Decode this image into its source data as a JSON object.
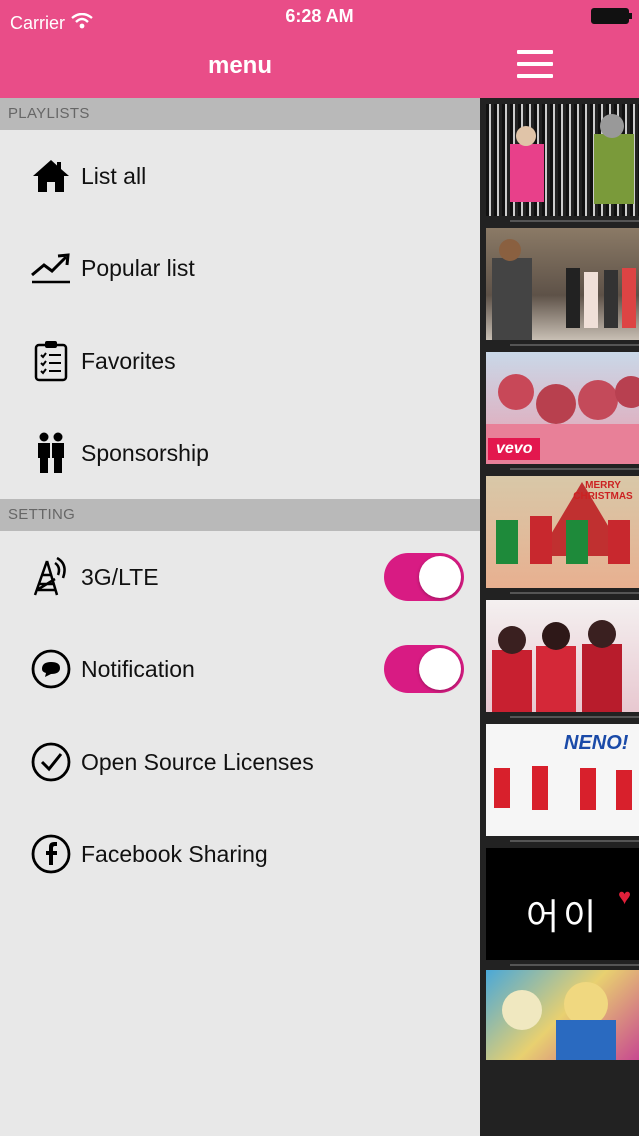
{
  "status_bar": {
    "carrier": "Carrier",
    "time": "6:28 AM"
  },
  "menu": {
    "title": "menu",
    "sections": [
      {
        "header": "PLAYLISTS",
        "items": [
          {
            "label": "List all",
            "icon": "home-icon"
          },
          {
            "label": "Popular list",
            "icon": "trending-up-icon"
          },
          {
            "label": "Favorites",
            "icon": "clipboard-checklist-icon"
          },
          {
            "label": "Sponsorship",
            "icon": "people-icon"
          }
        ]
      },
      {
        "header": "SETTING",
        "items": [
          {
            "label": "3G/LTE",
            "icon": "antenna-icon",
            "toggle": true
          },
          {
            "label": "Notification",
            "icon": "chat-bubble-icon",
            "toggle": true
          },
          {
            "label": "Open Source Licenses",
            "icon": "checkmark-circle-icon"
          },
          {
            "label": "Facebook Sharing",
            "icon": "facebook-icon"
          }
        ]
      }
    ]
  },
  "video_list": {
    "thumbnails": [
      {
        "overlay": ""
      },
      {
        "overlay": ""
      },
      {
        "overlay": "vevo"
      },
      {
        "overlay": "MERRY CHRISTMAS"
      },
      {
        "overlay": ""
      },
      {
        "overlay": "NENO!"
      },
      {
        "overlay": "어이"
      },
      {
        "overlay": ""
      }
    ]
  },
  "colors": {
    "accent": "#e94d88",
    "toggle_on": "#d81b83",
    "section_header_bg": "#b9b9b9",
    "content_bg": "#222222"
  }
}
